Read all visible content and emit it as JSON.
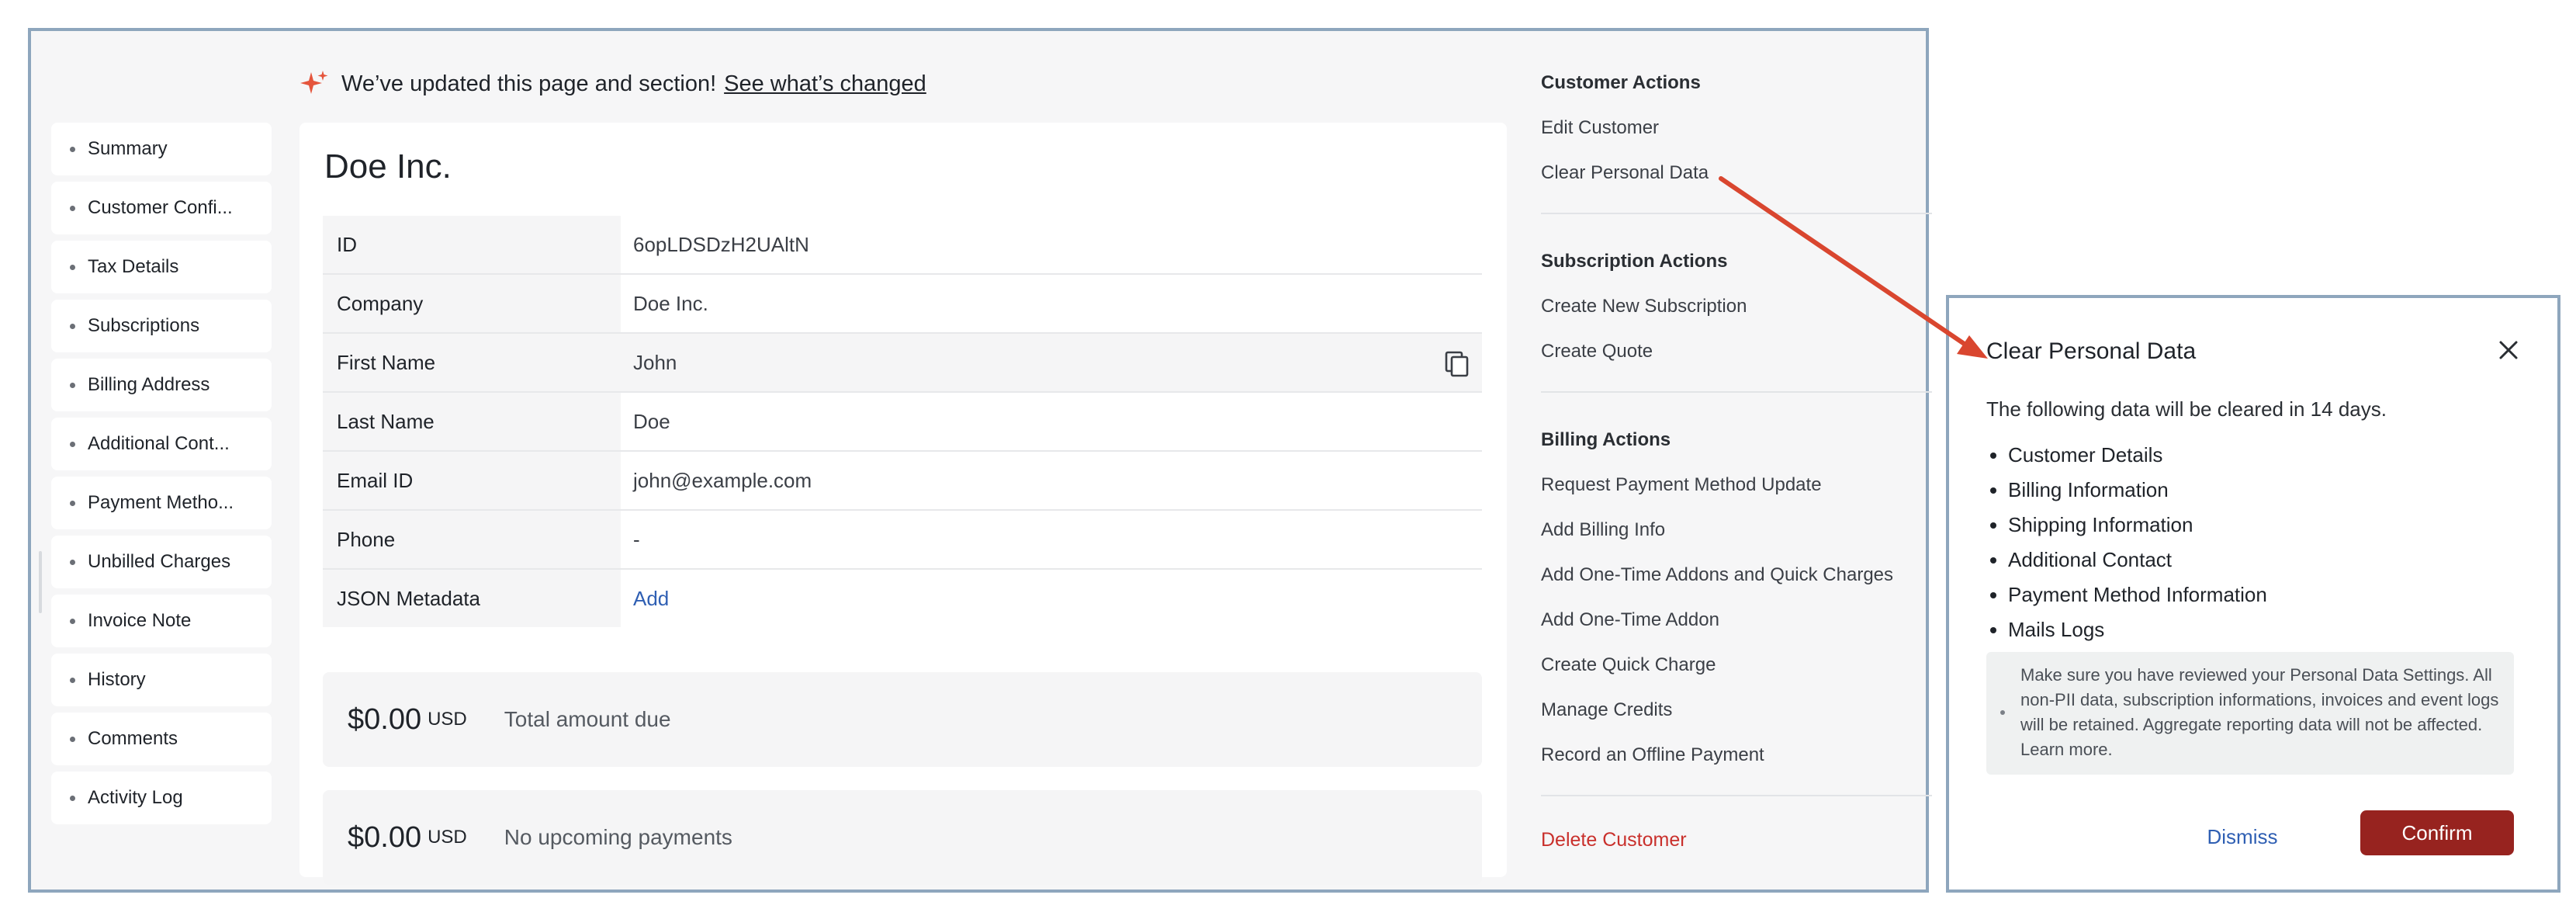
{
  "banner": {
    "text": "We’ve updated this page and section!",
    "link": "See what’s changed"
  },
  "nav": {
    "items": [
      {
        "label": "Summary"
      },
      {
        "label": "Customer Confi..."
      },
      {
        "label": "Tax Details"
      },
      {
        "label": "Subscriptions"
      },
      {
        "label": "Billing Address"
      },
      {
        "label": "Additional Cont..."
      },
      {
        "label": "Payment Metho..."
      },
      {
        "label": "Unbilled Charges"
      },
      {
        "label": "Invoice Note"
      },
      {
        "label": "History"
      },
      {
        "label": "Comments"
      },
      {
        "label": "Activity Log"
      }
    ]
  },
  "customer": {
    "name": "Doe Inc.",
    "fields": [
      {
        "key": "ID",
        "value": "6opLDSDzH2UAltN"
      },
      {
        "key": "Company",
        "value": "Doe Inc."
      },
      {
        "key": "First Name",
        "value": "John"
      },
      {
        "key": "Last Name",
        "value": "Doe"
      },
      {
        "key": "Email ID",
        "value": "john@example.com"
      },
      {
        "key": "Phone",
        "value": "-"
      },
      {
        "key": "JSON Metadata",
        "value": "Add"
      }
    ],
    "total_due": {
      "amount": "$0.00",
      "currency": "USD",
      "label": "Total amount due"
    },
    "upcoming": {
      "amount": "$0.00",
      "currency": "USD",
      "label": "No upcoming payments"
    }
  },
  "actions": {
    "customer": {
      "heading": "Customer Actions",
      "items": [
        "Edit Customer",
        "Clear Personal Data"
      ]
    },
    "subscription": {
      "heading": "Subscription Actions",
      "items": [
        "Create New Subscription",
        "Create Quote"
      ]
    },
    "billing": {
      "heading": "Billing Actions",
      "items": [
        "Request Payment Method Update",
        "Add Billing Info",
        "Add One-Time Addons and Quick Charges",
        "Add One-Time Addon",
        "Create Quick Charge",
        "Manage Credits",
        "Record an Offline Payment"
      ]
    },
    "delete": "Delete Customer"
  },
  "modal": {
    "title": "Clear Personal Data",
    "intro": "The following data will be cleared in 14 days.",
    "items": [
      "Customer Details",
      "Billing Information",
      "Shipping Information",
      "Additional Contact",
      "Payment Method Information",
      "Mails Logs"
    ],
    "note": "Make sure you have reviewed your Personal Data Settings. All non-PII data, subscription informations, invoices and event logs will be retained. Aggregate reporting data will not be affected. Learn more.",
    "dismiss": "Dismiss",
    "confirm": "Confirm"
  },
  "colors": {
    "accent_link": "#2f5fb3",
    "danger": "#c9302c",
    "confirm_button": "#97231f",
    "annotation_arrow": "#d9462f",
    "window_border": "#8ea6bd",
    "sparkle": "#e5553c"
  }
}
